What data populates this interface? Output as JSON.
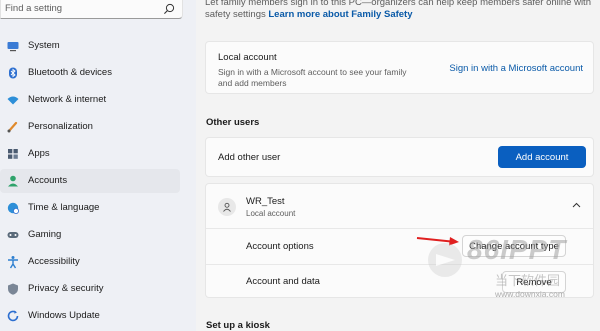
{
  "search": {
    "placeholder": "Find a setting"
  },
  "sidebar": {
    "items": [
      {
        "label": "System",
        "icon": "monitor-icon",
        "active": false
      },
      {
        "label": "Bluetooth & devices",
        "icon": "bluetooth-icon",
        "active": false
      },
      {
        "label": "Network & internet",
        "icon": "wifi-icon",
        "active": false
      },
      {
        "label": "Personalization",
        "icon": "brush-icon",
        "active": false
      },
      {
        "label": "Apps",
        "icon": "apps-icon",
        "active": false
      },
      {
        "label": "Accounts",
        "icon": "person-icon",
        "active": true
      },
      {
        "label": "Time & language",
        "icon": "globe-clock-icon",
        "active": false
      },
      {
        "label": "Gaming",
        "icon": "gamepad-icon",
        "active": false
      },
      {
        "label": "Accessibility",
        "icon": "accessibility-icon",
        "active": false
      },
      {
        "label": "Privacy & security",
        "icon": "shield-icon",
        "active": false
      },
      {
        "label": "Windows Update",
        "icon": "update-icon",
        "active": false
      }
    ]
  },
  "intro": {
    "text_line1": "Let family members sign in to this PC—organizers can help keep members safer online with",
    "text_line2": "safety settings",
    "link": "Learn more about Family Safety"
  },
  "local_account": {
    "title": "Local account",
    "description": "Sign in with a Microsoft account to see your family and add members",
    "link": "Sign in with a Microsoft account"
  },
  "other_users": {
    "section_title": "Other users",
    "add_label": "Add other user",
    "add_button": "Add account",
    "user": {
      "name": "WR_Test",
      "type": "Local account",
      "options_label": "Account options",
      "change_button": "Change account type",
      "data_label": "Account and data",
      "remove_button": "Remove"
    }
  },
  "kiosk": {
    "section_title": "Set up a kiosk"
  },
  "watermark": {
    "brand": "86IPPT",
    "chinese": "当下软件园",
    "url": "www.downxia.com"
  },
  "colors": {
    "accent": "#0a5fc0",
    "link": "#0a5aa8",
    "arrow": "#e02020"
  }
}
